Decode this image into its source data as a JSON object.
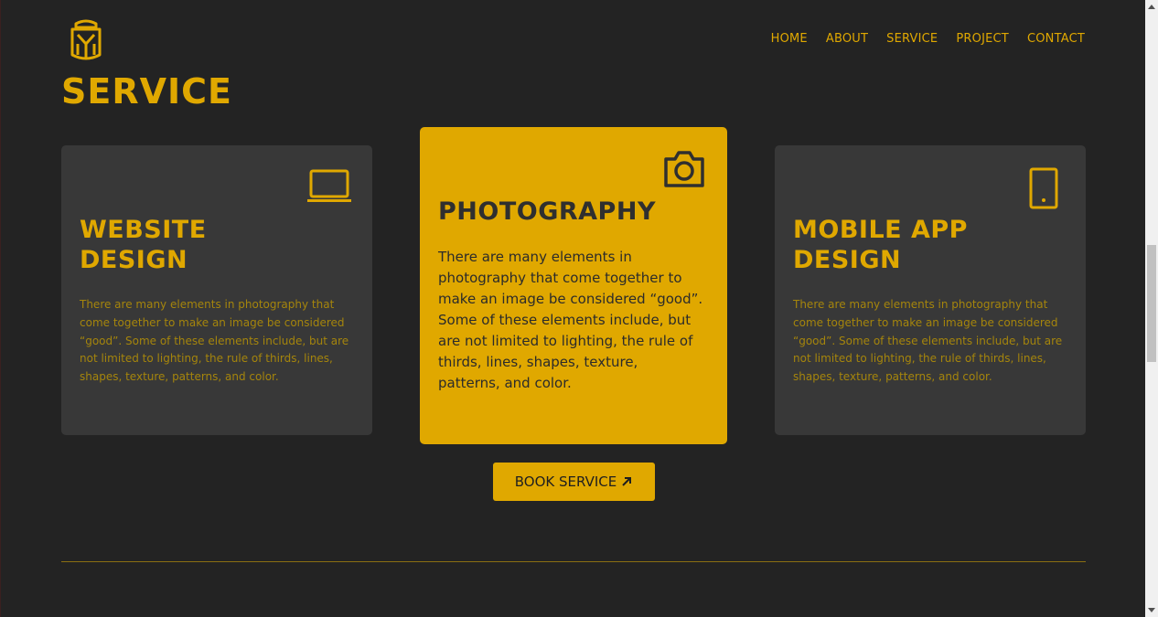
{
  "header": {
    "logo_icon": "helmet-logo-icon",
    "nav": [
      {
        "label": "HOME"
      },
      {
        "label": "ABOUT"
      },
      {
        "label": "SERVICE"
      },
      {
        "label": "PROJECT"
      },
      {
        "label": "CONTACT"
      }
    ]
  },
  "section": {
    "title": "SERVICE"
  },
  "cards": [
    {
      "icon": "laptop-icon",
      "title_line1": "WEBSITE",
      "title_line2": "DESIGN",
      "description": "There are many elements in photography that come together to make an image be considered “good”. Some of these elements include, but are not limited to lighting, the rule of thirds, lines, shapes, texture, patterns, and color."
    },
    {
      "icon": "camera-icon",
      "title": "PHOTOGRAPHY",
      "description": "There are many elements in photography that come together to make an image be considered “good”. Some of these elements include, but are not limited to lighting, the rule of thirds, lines, shapes, texture, patterns, and color."
    },
    {
      "icon": "mobile-phone-icon",
      "title_line1": "MOBILE APP",
      "title_line2": "DESIGN",
      "description": "There are many elements in photography that come together to make an image be considered “good”. Some of these elements include, but are not limited to lighting, the rule of thirds, lines, shapes, texture, patterns, and color."
    }
  ],
  "cta": {
    "label": "BOOK SERVICE",
    "icon": "arrow-up-right-icon"
  },
  "colors": {
    "background": "#232323",
    "accent": "#e0a800",
    "card": "#383838"
  }
}
